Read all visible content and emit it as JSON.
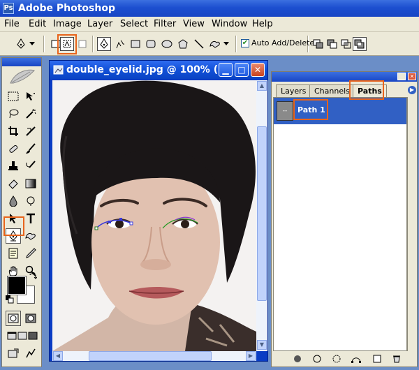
{
  "window": {
    "title": "Adobe Photoshop",
    "app_icon": "Ps"
  },
  "menu": [
    "File",
    "Edit",
    "Image",
    "Layer",
    "Select",
    "Filter",
    "View",
    "Window",
    "Help"
  ],
  "options_bar": {
    "auto_add_delete_label": "Auto Add/Delete",
    "auto_add_delete_checked": true
  },
  "document": {
    "title": "double_eyelid.jpg @ 100% (..."
  },
  "paths_panel": {
    "tabs": [
      "Layers",
      "Channels",
      "Paths"
    ],
    "active_tab": "Paths",
    "paths": [
      {
        "name": "Path 1",
        "thumb": "--"
      }
    ]
  },
  "colors": {
    "accent": "#e8641c",
    "selection": "#3160c4",
    "title_bar": "#1c4fd0"
  }
}
